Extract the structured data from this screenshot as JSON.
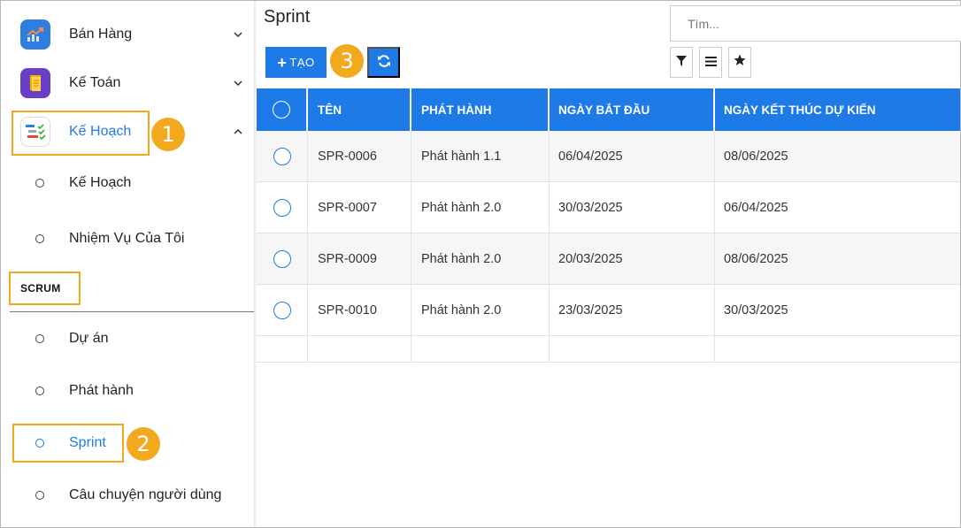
{
  "sidebar": {
    "apps": [
      {
        "label": "Bán Hàng",
        "icon": "trending-up-icon",
        "color": "#2f7de1"
      },
      {
        "label": "Kế Toán",
        "icon": "document-icon",
        "color": "#6a3fc8"
      },
      {
        "label": "Kế Hoạch",
        "icon": "planning-chart-icon",
        "color": "#ffffff"
      }
    ],
    "sub_items": [
      {
        "label": "Kế Hoạch"
      },
      {
        "label": "Nhiệm Vụ Của Tôi"
      }
    ],
    "section": "SCRUM",
    "scrum_items": [
      {
        "label": "Dự án"
      },
      {
        "label": "Phát hành"
      },
      {
        "label": "Sprint"
      },
      {
        "label": "Câu chuyện người dùng"
      }
    ]
  },
  "badges": [
    "1",
    "2",
    "3"
  ],
  "main": {
    "title": "Sprint",
    "search_placeholder": "Tìm...",
    "create_label": "TẠO",
    "create_plus": "+",
    "columns": [
      "TÊN",
      "PHÁT HÀNH",
      "NGÀY BẮT ĐẦU",
      "NGÀY KẾT THÚC DỰ KIẾN"
    ],
    "rows": [
      {
        "name": "SPR-0006",
        "release": "Phát hành 1.1",
        "start": "06/04/2025",
        "end": "08/06/2025"
      },
      {
        "name": "SPR-0007",
        "release": "Phát hành 2.0",
        "start": "30/03/2025",
        "end": "06/04/2025"
      },
      {
        "name": "SPR-0009",
        "release": "Phát hành 2.0",
        "start": "20/03/2025",
        "end": "08/06/2025"
      },
      {
        "name": "SPR-0010",
        "release": "Phát hành 2.0",
        "start": "23/03/2025",
        "end": "30/03/2025"
      }
    ]
  },
  "colors": {
    "accent": "#1e7ae6",
    "highlight": "#f2a91d"
  }
}
